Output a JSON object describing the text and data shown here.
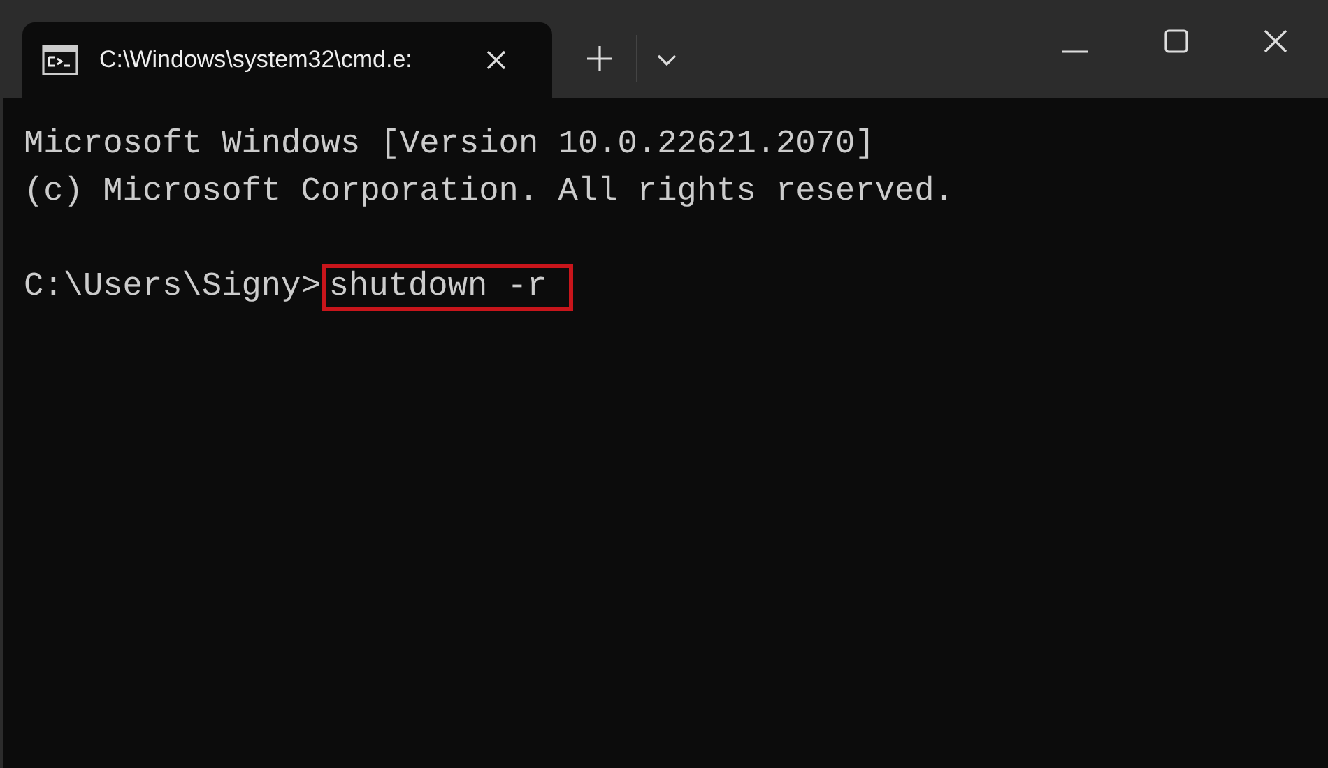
{
  "window": {
    "tab": {
      "title": "C:\\Windows\\system32\\cmd.e:",
      "selected": true
    }
  },
  "terminal": {
    "lines": [
      {
        "text": "Microsoft Windows [Version 10.0.22621.2070]"
      },
      {
        "text": "(c) Microsoft Corporation. All rights reserved."
      },
      {
        "prompt": "C:\\Users\\Signy>",
        "command": "shutdown -r",
        "highlighted": true
      }
    ]
  }
}
